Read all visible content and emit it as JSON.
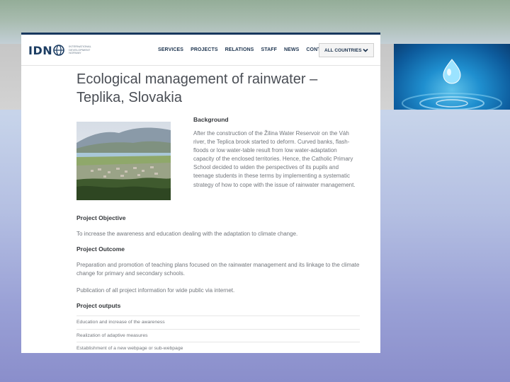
{
  "nav": {
    "logo_text": "IDN",
    "logo_sub": "International Development Norway",
    "menu": [
      "SERVICES",
      "PROJECTS",
      "RELATIONS",
      "STAFF",
      "NEWS",
      "CONTACT"
    ],
    "country_select": "ALL COUNTRIES"
  },
  "article": {
    "title_line1": "Ecological management of rainwater –",
    "title_line2": "Teplika, Slovakia",
    "background_heading": "Background",
    "background_text": "After the construction of the Žilina Water Reservoir on the Váh river, the Teplica brook started to deform. Curved banks, flash-floods or low water-table result from low water-adaptation capacity of the enclosed territories. Hence, the Catholic Primary School decided to widen the perspectives of its pupils and teenage students in these terms by implementing a systematic strategy of how to cope with the issue of rainwater management.",
    "objective_heading": "Project Objective",
    "objective_text": "To increase the awareness and education dealing with the adaptation to climate change.",
    "outcome_heading": "Project Outcome",
    "outcome_text1": "Preparation and promotion of teaching plans focused on the rainwater management and its linkage to the climate change for primary and secondary schools.",
    "outcome_text2": "Publication of all project information for wide public via internet.",
    "outputs_heading": "Project outputs",
    "outputs": [
      "Education and increase of the awareness",
      "Realization of adaptive measures",
      "Establishment of a new webpage or sub-webpage"
    ]
  },
  "colors": {
    "brand_navy": "#1c3d63",
    "text_gray": "#72767c"
  }
}
